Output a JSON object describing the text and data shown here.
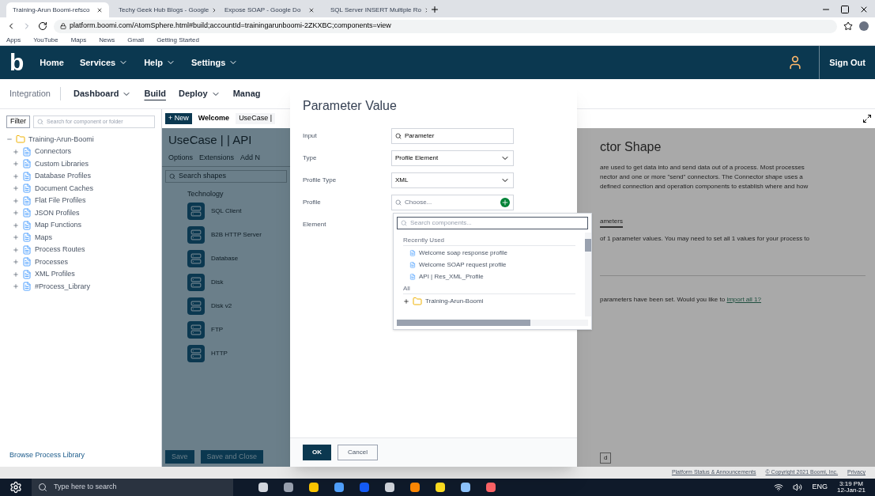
{
  "browser": {
    "tabs": [
      {
        "title": "Training-Arun Boomi-refsco",
        "selected": true
      },
      {
        "title": "Techy Geek Hub Blogs - Google",
        "selected": false
      },
      {
        "title": "Expose SOAP - Google Do",
        "selected": false
      },
      {
        "title": "SQL Server INSERT Multiple Ro",
        "selected": false
      }
    ],
    "url": "platform.boomi.com/AtomSphere.html#build;accountId=trainingarunboomi-2ZKXBC;components=view",
    "bookmarks": [
      "Apps",
      "YouTube",
      "Maps",
      "News",
      "Gmail",
      "Getting Started"
    ]
  },
  "header": {
    "logo": "b",
    "nav": [
      {
        "label": "Home",
        "dropdown": false
      },
      {
        "label": "Services",
        "dropdown": true
      },
      {
        "label": "Help",
        "dropdown": true
      },
      {
        "label": "Settings",
        "dropdown": true
      }
    ],
    "sign_out": "Sign Out"
  },
  "subnav": {
    "product": "Integration",
    "items": [
      {
        "label": "Dashboard",
        "dropdown": true,
        "selected": false
      },
      {
        "label": "Build",
        "dropdown": false,
        "selected": true
      },
      {
        "label": "Deploy",
        "dropdown": true,
        "selected": false
      },
      {
        "label": "Manag",
        "dropdown": false,
        "selected": false
      }
    ]
  },
  "sidebar": {
    "filter": "Filter",
    "search_placeholder": "Search for component or folder",
    "tree": {
      "label": "Training-Arun-Boomi",
      "expanded": true,
      "children": [
        {
          "label": "Connectors"
        },
        {
          "label": "Custom Libraries"
        },
        {
          "label": "Database Profiles"
        },
        {
          "label": "Document Caches"
        },
        {
          "label": "Flat File Profiles"
        },
        {
          "label": "JSON Profiles"
        },
        {
          "label": "Map Functions"
        },
        {
          "label": "Maps"
        },
        {
          "label": "Process Routes"
        },
        {
          "label": "Processes"
        },
        {
          "label": "XML Profiles"
        },
        {
          "label": "#Process_Library"
        }
      ]
    },
    "footer_link": "Browse Process Library"
  },
  "canvas": {
    "new_button": "+ New",
    "tabs": [
      {
        "label": "Welcome",
        "selected": false
      },
      {
        "label": "UseCase |",
        "selected": true
      }
    ],
    "title": "UseCase | | API",
    "toolbar": [
      "Options",
      "Extensions",
      "Add N"
    ],
    "search_placeholder": "Search shapes",
    "group": "Technology",
    "shapes": [
      "SQL Client",
      "B2B HTTP Server",
      "Database",
      "Disk",
      "Disk v2",
      "FTP",
      "HTTP"
    ],
    "buttons": [
      "Save",
      "Save and Close"
    ]
  },
  "detail": {
    "title": "ctor Shape",
    "paragraph": [
      "are used to get data into and send data out of a process. Most processes",
      "nector and one or more \"send\" connectors. The Connector shape uses a",
      "defined connection and operation components to establish where and how"
    ],
    "tab": "ameters",
    "note": "of 1 parameter values. You may need to set all 1 values for your process to",
    "prompt": "parameters have been set. Would you like to ",
    "prompt_link": "import all 1?",
    "button": "d"
  },
  "dialog": {
    "title": "Parameter Value",
    "fields": [
      {
        "label": "Input",
        "kind": "search",
        "value": "Parameter"
      },
      {
        "label": "Type",
        "kind": "select",
        "value": "Profile Element"
      },
      {
        "label": "Profile Type",
        "kind": "select",
        "value": "XML"
      },
      {
        "label": "Profile",
        "kind": "picker",
        "placeholder": "Choose..."
      },
      {
        "label": "Element",
        "kind": "empty"
      }
    ],
    "dropdown": {
      "search_placeholder": "Search components...",
      "sections": [
        {
          "title": "Recently Used",
          "items": [
            {
              "label": "Welcome soap response profile",
              "kind": "profile"
            },
            {
              "label": "Welcome SOAP request profile",
              "kind": "profile"
            },
            {
              "label": "API | Res_XML_Profile",
              "kind": "profile"
            }
          ]
        },
        {
          "title": "All",
          "items": [
            {
              "label": "Training-Arun-Boomi",
              "kind": "folder"
            }
          ]
        }
      ]
    },
    "buttons": [
      {
        "label": "OK",
        "primary": true
      },
      {
        "label": "Cancel",
        "primary": false
      }
    ]
  },
  "footer": [
    "Platform Status & Announcements",
    "© Copyright 2021 Boomi, Inc.",
    "Privacy"
  ],
  "taskbar": {
    "search_placeholder": "Type here to search",
    "lang": "ENG",
    "time": "3:19 PM",
    "date": "12-Jan-21"
  }
}
